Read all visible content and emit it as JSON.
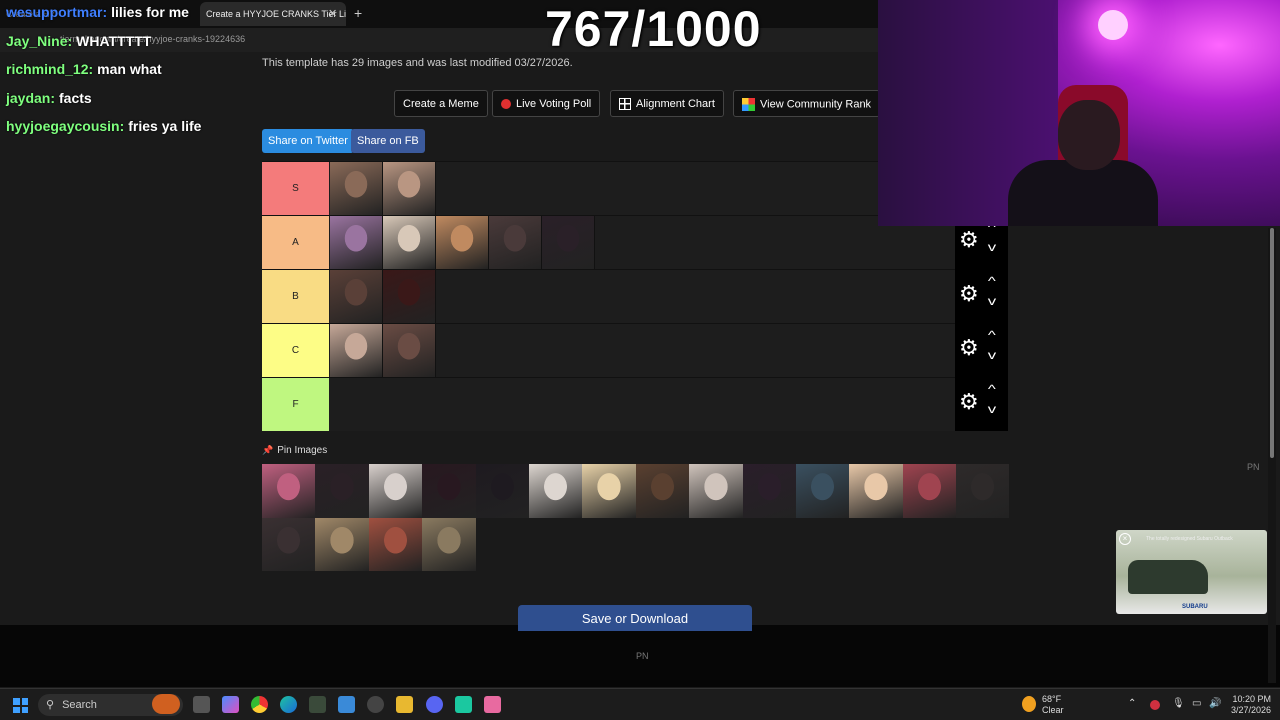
{
  "browser": {
    "background_tab": "Create a HY",
    "tab_title": "Create a HYYJOE CRANKS Tier List",
    "tab_close": "✕",
    "new_tab": "+",
    "url": "tiermaker.com/create/hyyjoe-cranks-19224636"
  },
  "overlay": {
    "counter": "767/1000",
    "chat": [
      {
        "user": "wesupportmar:",
        "msg": "lilies for me",
        "color": "#3f7fff"
      },
      {
        "user": "Jay_Nine:",
        "msg": "WHATTTTT",
        "color": "#7fff7f"
      },
      {
        "user": "richmind_12:",
        "msg": "man what",
        "color": "#7fff7f"
      },
      {
        "user": "jaydan:",
        "msg": "facts",
        "color": "#7fff7f"
      },
      {
        "user": "hyyjoegaycousin:",
        "msg": "fries ya life",
        "color": "#7fff7f"
      }
    ]
  },
  "page": {
    "info": "This template has 29 images and was last modified 03/27/2026.",
    "buttons": {
      "create_meme": "Create a Meme",
      "live_poll": "Live Voting Poll",
      "alignment": "Alignment Chart",
      "community": "View Community Rank"
    },
    "share": {
      "twitter": "Share on Twitter",
      "fb": "Share on FB",
      "twitter_color": "#2b8ce0",
      "fb_color": "#3b5a9c"
    },
    "tiers": [
      {
        "label": "S",
        "color": "#f47b7b",
        "thumbs": [
          "#8a6a58",
          "#b99682"
        ]
      },
      {
        "label": "A",
        "color": "#f7bb86",
        "thumbs": [
          "#9a74a0",
          "#d8c8b8",
          "#c08a60",
          "#4a3a3a",
          "#2a2028"
        ]
      },
      {
        "label": "B",
        "color": "#f9dc84",
        "thumbs": [
          "#5a4038",
          "#3a1818"
        ]
      },
      {
        "label": "C",
        "color": "#fdfd86",
        "thumbs": [
          "#c6a898",
          "#6a4c44"
        ]
      },
      {
        "label": "F",
        "color": "#bff780",
        "thumbs": []
      }
    ],
    "pin_label": "Pin Images",
    "pin_icon": "📌",
    "pool": [
      "#c06080",
      "#2a2026",
      "#d8d0cc",
      "#281820",
      "#1e1a20",
      "#ddd6d0",
      "#e8d2a8",
      "#5a4030",
      "#d0c4bc",
      "#2a1e2a",
      "#3a5060",
      "#e8c8a8",
      "#a04450",
      "#2e2a2a",
      "#3a3032",
      "#a08868",
      "#a05040",
      "#8a7a60"
    ],
    "save": "Save or Download",
    "pn_right": "PN",
    "pn_footer": "PN",
    "ad_headline": "The totally redesigned Subaru Outback",
    "ad_brand": "SUBARU"
  },
  "taskbar": {
    "search": "Search",
    "weather_temp": "68°F",
    "weather_desc": "Clear",
    "time": "10:20 PM",
    "date": "3/27/2026"
  }
}
